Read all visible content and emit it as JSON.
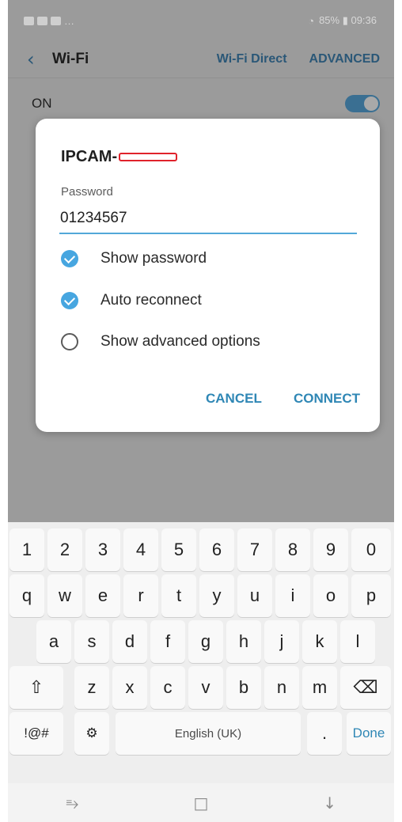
{
  "status_bar": {
    "right_text": "85% ▮ 09:36"
  },
  "app_bar": {
    "back_icon": "‹",
    "title": "Wi-Fi",
    "action_wifi_direct": "Wi-Fi Direct",
    "action_advanced": "ADVANCED"
  },
  "wifi_toggle": {
    "label": "ON",
    "state": "on"
  },
  "dialog": {
    "ssid": "IPCAM-",
    "password_label": "Password",
    "password_value": "01234567",
    "options": [
      {
        "label": "Show password",
        "checked": true
      },
      {
        "label": "Auto reconnect",
        "checked": true
      },
      {
        "label": "Show advanced options",
        "checked": false
      }
    ],
    "cancel": "CANCEL",
    "connect": "CONNECT",
    "accent_color": "#47a6e0"
  },
  "keyboard": {
    "row1": [
      "1",
      "2",
      "3",
      "4",
      "5",
      "6",
      "7",
      "8",
      "9",
      "0"
    ],
    "row2": [
      "q",
      "w",
      "e",
      "r",
      "t",
      "y",
      "u",
      "i",
      "o",
      "p"
    ],
    "row3": [
      "a",
      "s",
      "d",
      "f",
      "g",
      "h",
      "j",
      "k",
      "l"
    ],
    "row4": [
      "z",
      "x",
      "c",
      "v",
      "b",
      "n",
      "m"
    ],
    "shift_icon": "⇧",
    "backspace_icon": "⌫",
    "symbols": "!@#",
    "settings_icon": "⚙",
    "space": "English (UK)",
    "period": ".",
    "done": "Done"
  },
  "nav_bar": {
    "recent_icon": "⥱",
    "home_icon": "□",
    "back_icon": "↓"
  }
}
